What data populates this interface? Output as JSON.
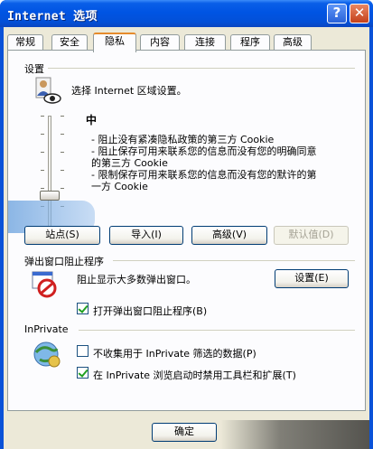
{
  "window": {
    "title": "Internet 选项"
  },
  "titlebar_buttons": {
    "help": "?",
    "close": "✕"
  },
  "tabs": [
    {
      "label": "常规"
    },
    {
      "label": "安全"
    },
    {
      "label": "隐私"
    },
    {
      "label": "内容"
    },
    {
      "label": "连接"
    },
    {
      "label": "程序"
    },
    {
      "label": "高级"
    }
  ],
  "active_tab": "隐私",
  "settings": {
    "group_label": "设置",
    "zone_text": "选择 Internet 区域设置。",
    "level": "中",
    "descriptions": [
      "- 阻止没有紧凑隐私政策的第三方 Cookie",
      "- 阻止保存可用来联系您的信息而没有您的明确同意",
      "的第三方 Cookie",
      "- 限制保存可用来联系您的信息而没有您的默许的第",
      "一方 Cookie"
    ],
    "buttons": {
      "sites": "站点(S)",
      "import": "导入(I)",
      "advanced": "高级(V)",
      "default": "默认值(D)"
    }
  },
  "popup": {
    "group_label": "弹出窗口阻止程序",
    "description": "阻止显示大多数弹出窗口。",
    "settings_button": "设置(E)",
    "enable_checkbox": "打开弹出窗口阻止程序(B)"
  },
  "inprivate": {
    "group_label": "InPrivate",
    "no_collect_checkbox": "不收集用于 InPrivate 筛选的数据(P)",
    "disable_toolbars_checkbox": "在 InPrivate 浏览启动时禁用工具栏和扩展(T)"
  },
  "footer": {
    "ok_button": "确定"
  }
}
